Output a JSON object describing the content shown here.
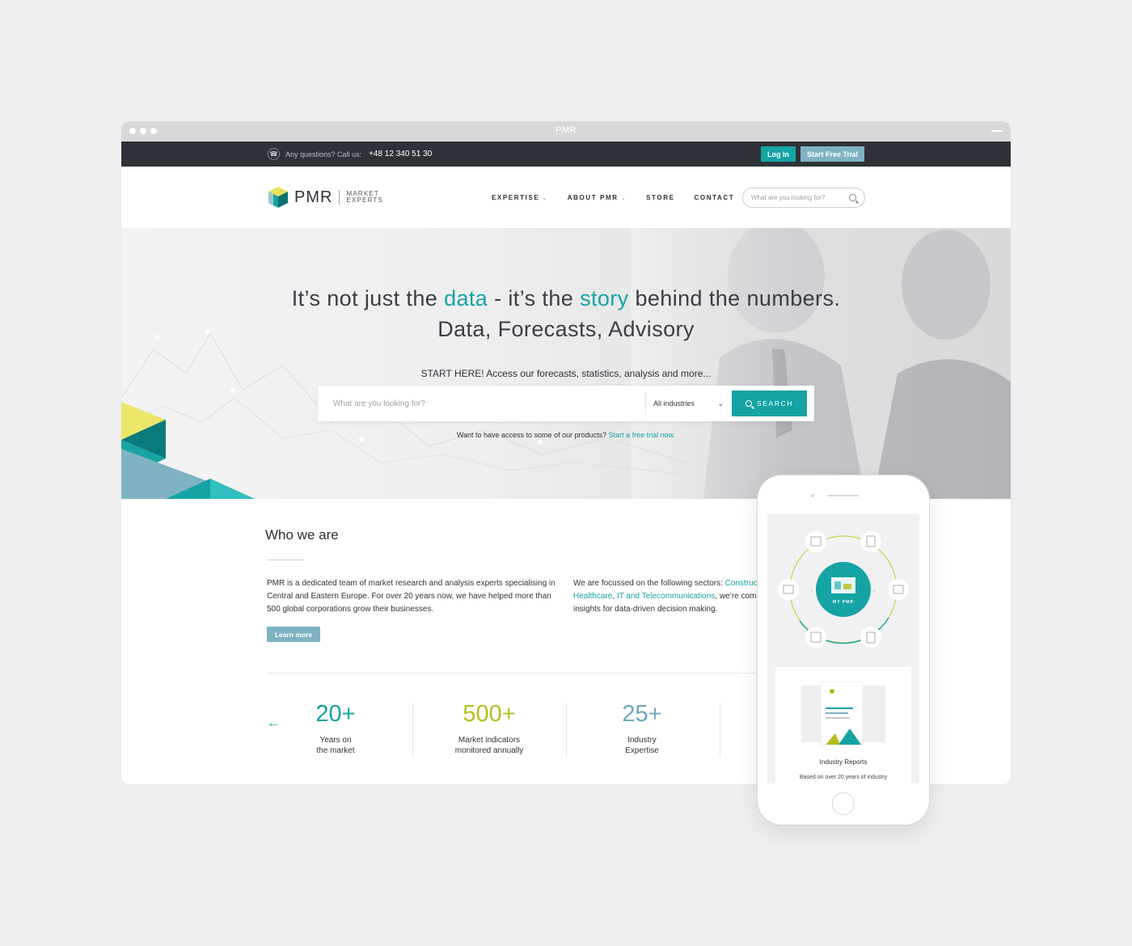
{
  "window": {
    "title": "PMR"
  },
  "topbar": {
    "question": "Any questions? Call us:",
    "phone": "+48 12 340 51 30",
    "login": "Log In",
    "trial": "Start Free Trial"
  },
  "header": {
    "logo_text": "PMR",
    "logo_sub1": "MARKET",
    "logo_sub2": "EXPERTS",
    "nav": [
      {
        "label": "EXPERTISE",
        "has_dropdown": true
      },
      {
        "label": "ABOUT PMR",
        "has_dropdown": true
      },
      {
        "label": "STORE",
        "has_dropdown": false
      },
      {
        "label": "CONTACT",
        "has_dropdown": false
      }
    ],
    "search_placeholder": "What are you looking for?"
  },
  "hero": {
    "headline_a": "It’s not just the ",
    "headline_b": "data",
    "headline_c": " - it’s the ",
    "headline_d": "story",
    "headline_e": " behind the numbers.",
    "headline_line2": "Data, Forecasts, Advisory",
    "start_here": "START HERE! Access our forecasts, statistics, analysis and more...",
    "search_placeholder": "What are you looking for?",
    "industry_select": "All industries",
    "search_button": "SEARCH",
    "trial_text": "Want to have access to some of our products? ",
    "trial_link": "Start a free trial now."
  },
  "who": {
    "title": "Who we are",
    "para1": "PMR is a dedicated team of market research and analysis experts specialising in Central and Eastern Europe. For over 20 years now, we have helped more than 500 global corporations grow their businesses.",
    "para2_a": "We are focussed on the following sectors: ",
    "para2_link1": "Construc",
    "para2_link2": "Healthcare",
    "para2_b": ", ",
    "para2_link3": "IT and Telecommunications",
    "para2_c": ", we’re comm",
    "para2_d": "insights for data-driven decision making.",
    "learn_more": "Learn more"
  },
  "stats": [
    {
      "value": "20+",
      "label1": "Years on",
      "label2": "the market",
      "color": "#16a3a4"
    },
    {
      "value": "500+",
      "label1": "Market indicators",
      "label2": "monitored annually",
      "color": "#b5bd1c"
    },
    {
      "value": "25+",
      "label1": "Industry",
      "label2": "Expertise",
      "color": "#6fa8b8"
    }
  ],
  "phone": {
    "center_label": "MY PMR",
    "card_title": "Industry Reports",
    "card_sub": "Based on over 20 years of industry"
  },
  "colors": {
    "accent": "#16a3a4",
    "dark": "#2f3339",
    "muted_blue": "#7fb3c2",
    "lime": "#b5bd1c"
  }
}
